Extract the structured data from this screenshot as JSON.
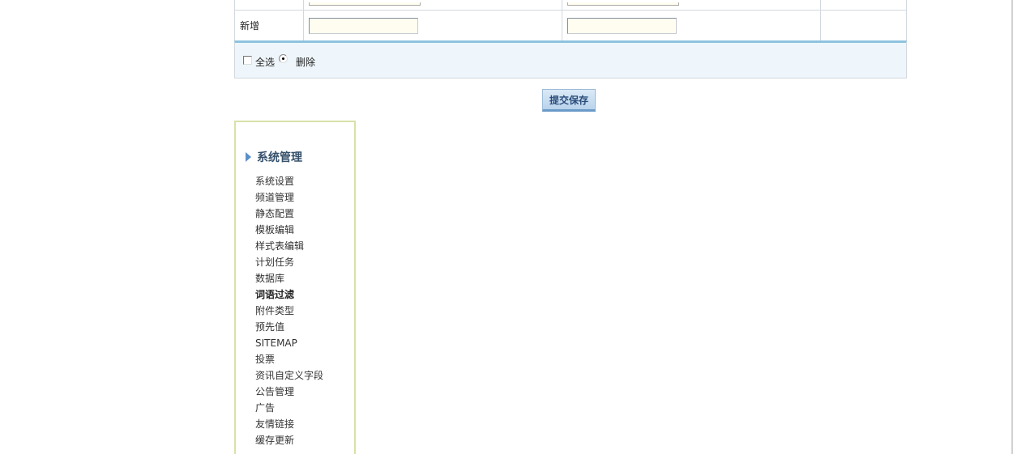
{
  "form": {
    "add_label": "新增"
  },
  "select_bar": {
    "select_all_label": "全选",
    "delete_label": "删除"
  },
  "submit": {
    "label": "提交保存"
  },
  "side_menu": {
    "title": "系统管理",
    "items": [
      {
        "label": "系统设置"
      },
      {
        "label": "频道管理"
      },
      {
        "label": "静态配置"
      },
      {
        "label": "模板编辑"
      },
      {
        "label": "样式表编辑"
      },
      {
        "label": "计划任务"
      },
      {
        "label": "数据库"
      },
      {
        "label": "词语过滤",
        "active": true
      },
      {
        "label": "附件类型"
      },
      {
        "label": "预先值"
      },
      {
        "label": "SITEMAP"
      },
      {
        "label": "投票"
      },
      {
        "label": "资讯自定义字段"
      },
      {
        "label": "公告管理"
      },
      {
        "label": "广告"
      },
      {
        "label": "友情链接"
      },
      {
        "label": "缓存更新"
      }
    ]
  }
}
